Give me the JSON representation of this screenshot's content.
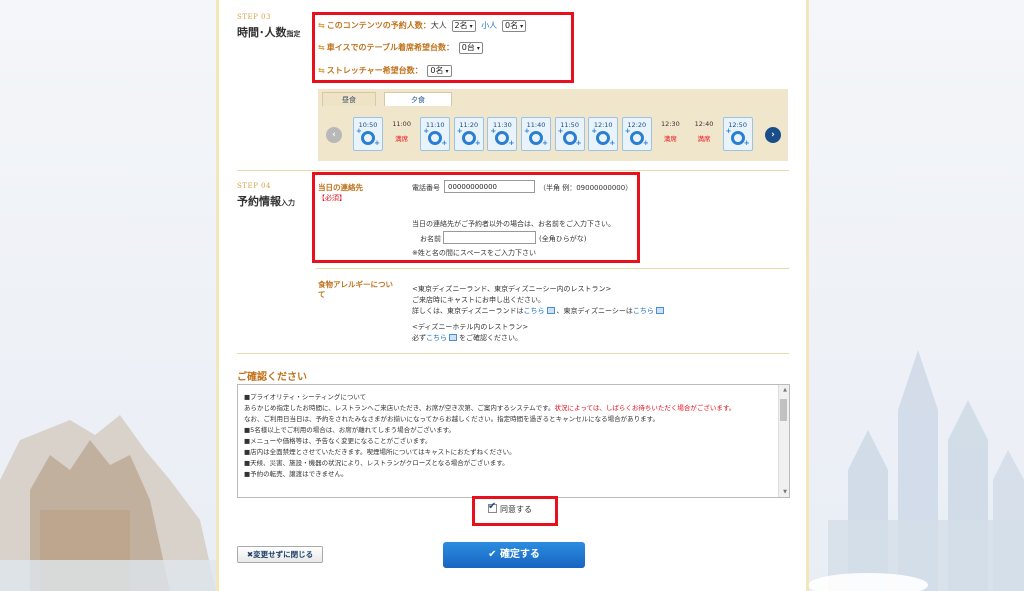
{
  "step3": {
    "label": "STEP 03",
    "title": "時間･人数",
    "title_small": "指定",
    "q1": "このコンテンツの予約人数：",
    "adult_label": "大人",
    "adult_value": "2名",
    "child_label": "小人",
    "child_value": "0名",
    "q2": "車イスでのテーブル着席希望台数：",
    "wheelchair_value": "0台",
    "q3": "ストレッチャー希望台数：",
    "stretcher_value": "0名"
  },
  "tabs": [
    {
      "label": "昼食"
    },
    {
      "label": "夕食"
    }
  ],
  "slots": [
    {
      "time": "10:50"
    },
    {
      "time": "11:00",
      "status": "満席"
    },
    {
      "time": "11:10"
    },
    {
      "time": "11:20"
    },
    {
      "time": "11:30"
    },
    {
      "time": "11:40"
    },
    {
      "time": "11:50"
    },
    {
      "time": "12:10"
    },
    {
      "time": "12:20"
    },
    {
      "time": "12:30",
      "status": "満席"
    },
    {
      "time": "12:40",
      "status": "満席"
    },
    {
      "time": "12:50"
    }
  ],
  "step4": {
    "label": "STEP 04",
    "title": "予約情報",
    "title_small": "入力",
    "contact_label": "当日の連絡先",
    "required": "【必須】",
    "phone_label": "電話番号",
    "phone_value": "00000000000",
    "phone_hint": "（半角 例：09000000000）",
    "other_note": "当日の連絡先がご予約者以外の場合は、お名前をご入力下さい。",
    "name_label": "お名前",
    "name_hint": "(全角ひらがな)",
    "name_note": "※姓と名の間にスペースをご入力下さい",
    "allergy_label": "食物アレルギーについて",
    "allergy_l1": "<東京ディズニーランド、東京ディズニーシー内のレストラン>",
    "allergy_l2": "ご来店時にキャストにお申し出ください。",
    "allergy_l3a": "詳しくは、東京ディズニーランドは",
    "allergy_link": "こちら",
    "allergy_l3b": "、東京ディズニーシーは",
    "allergy_l4": "<ディズニーホテル内のレストラン>",
    "allergy_l5a": "必ず",
    "allergy_l5b": "をご確認ください。"
  },
  "confirm": {
    "heading": "ご確認ください",
    "lines": [
      "■プライオリティ・シーティングについて",
      "あらかじめ指定したお時間に、レストランへご来店いただき、お席が空き次第、ご案内するシステムです。",
      "なお、ご利用日当日は、予約をされたみなさまがお揃いになってからお越しください。指定時間を過ぎるとキャンセルになる場合があります。",
      "■5名様以上でご利用の場合は、お席が離れてしまう場合がございます。",
      "■メニューや価格等は、予告なく変更になることがございます。",
      "■店内は全面禁煙とさせていただきます。喫煙場所についてはキャストにおたずねください。",
      "■天候、災害、施設・機器の状況により、レストランがクローズとなる場合がございます。",
      "■予約の転売、譲渡はできません。"
    ],
    "red_part": "状況によっては、しばらくお待ちいただく場合がございます。",
    "agree_label": "同意する"
  },
  "buttons": {
    "close": "変更せずに閉じる",
    "submit": "確定する"
  },
  "colors": {
    "accent": "#1665c0",
    "highlight": "#e8101c",
    "gold": "#c0721c"
  }
}
